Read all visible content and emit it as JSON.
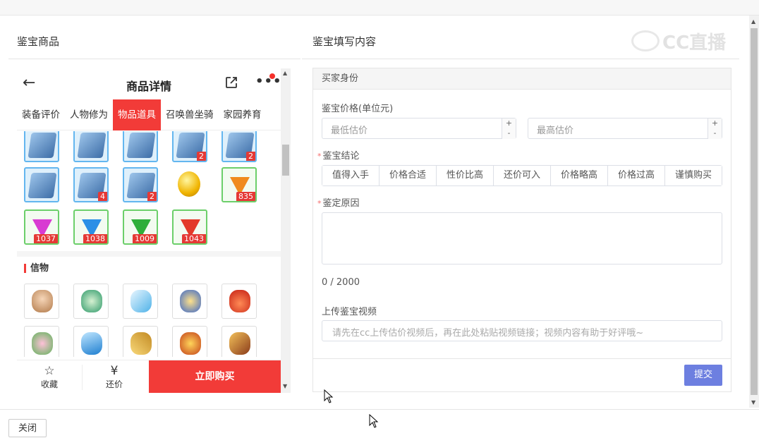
{
  "left_panel": {
    "title": "鉴宝商品"
  },
  "right_panel": {
    "title": "鉴宝填写内容",
    "watermark": "CC直播"
  },
  "phone": {
    "nav": {
      "back_icon": "arrow-left-icon",
      "title": "商品详情",
      "share_icon": "share-icon",
      "more_icon": "more-dots-icon"
    },
    "tabs": [
      {
        "label": "装备评价",
        "active": false
      },
      {
        "label": "人物修为",
        "active": false
      },
      {
        "label": "物品道具",
        "active": true
      },
      {
        "label": "召唤兽坐骑",
        "active": false
      },
      {
        "label": "家园养育",
        "active": false
      }
    ],
    "items_row1_badges": [
      "",
      "",
      "",
      "2",
      "2"
    ],
    "items_row2": [
      {
        "kind": "book",
        "badge": ""
      },
      {
        "kind": "book",
        "badge": "4"
      },
      {
        "kind": "book",
        "badge": "2"
      },
      {
        "kind": "orb",
        "badge": ""
      },
      {
        "kind": "gem-orange",
        "badge": "835"
      }
    ],
    "items_row3": [
      {
        "kind": "gem-magenta",
        "badge": "1037"
      },
      {
        "kind": "gem-blue",
        "badge": "1038"
      },
      {
        "kind": "gem-green",
        "badge": "1009"
      },
      {
        "kind": "gem-red",
        "badge": "1043"
      }
    ],
    "section_title": "信物",
    "bottom": {
      "favorite_label": "收藏",
      "bargain_label": "还价",
      "buy_label": "立即购买",
      "bargain_icon": "¥"
    }
  },
  "form": {
    "header": "买家身份",
    "price_label": "鉴宝价格(单位元)",
    "min_placeholder": "最低估价",
    "max_placeholder": "最高估价",
    "plus": "+",
    "minus": "-",
    "conclusion_label": "鉴宝结论",
    "conclusions": [
      "值得入手",
      "价格合适",
      "性价比高",
      "还价可入",
      "价格略高",
      "价格过高",
      "谨慎购买"
    ],
    "reason_label": "鉴定原因",
    "counter": "0 / 2000",
    "video_label": "上传鉴宝视频",
    "video_placeholder": "请先在cc上传估价视频后，再在此处粘贴视频链接；视频内容有助于好评哦~",
    "submit_label": "提交",
    "required_mark": "*"
  },
  "footer": {
    "close_label": "关闭"
  }
}
